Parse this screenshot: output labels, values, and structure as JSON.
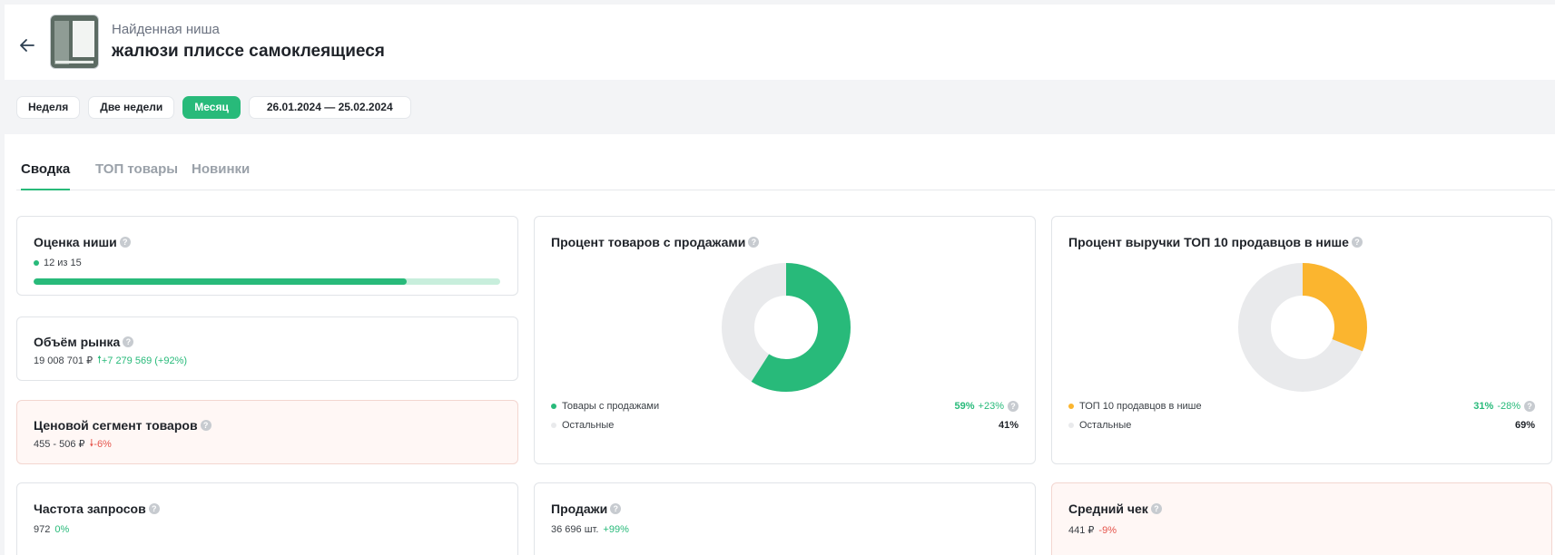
{
  "header": {
    "subtitle": "Найденная ниша",
    "title": "жалюзи плиссе самоклеящиеся",
    "back_icon": "arrow-left-icon"
  },
  "periods": {
    "week": "Неделя",
    "two_weeks": "Две недели",
    "month": "Месяц",
    "active": "month",
    "date_range": "26.01.2024 — 25.02.2024"
  },
  "tabs": [
    {
      "label": "Сводка",
      "active": true
    },
    {
      "label": "ТОП товары",
      "active": false
    },
    {
      "label": "Новинки",
      "active": false
    }
  ],
  "niche_score": {
    "title": "Оценка ниши",
    "value": "12 из 15",
    "progress": 0.8
  },
  "market_volume": {
    "title": "Объём рынка",
    "value": "19 008 701 ₽",
    "delta": "+7 279 569 (+92%)"
  },
  "price_segment": {
    "title": "Ценовой сегмент товаров",
    "value": "455 - 506 ₽",
    "delta": "-6%"
  },
  "query_frequency": {
    "title": "Частота запросов",
    "value": "972",
    "delta": "0%"
  },
  "sales": {
    "title": "Продажи",
    "value": "36 696 шт.",
    "delta": "+99%"
  },
  "avg_check": {
    "title": "Средний чек",
    "value": "441 ₽",
    "delta": "-9%"
  },
  "products_with_sales": {
    "title": "Процент товаров с продажами",
    "row1_label": "Товары с продажами",
    "row1_pct": "59%",
    "row1_delta": "+23%",
    "row2_label": "Остальные",
    "row2_pct": "41%",
    "share": 0.59,
    "color": "#28ba7a"
  },
  "top10_revenue": {
    "title": "Процент выручки ТОП 10 продавцов в нише",
    "row1_label": "ТОП 10 продавцов в нише",
    "row1_pct": "31%",
    "row1_delta": "-28%",
    "row2_label": "Остальные",
    "row2_pct": "69%",
    "share": 0.31,
    "color": "#fbb52f"
  },
  "colors": {
    "accent": "#28ba7a",
    "negative": "#e5544b",
    "rest": "#e9eaec"
  }
}
